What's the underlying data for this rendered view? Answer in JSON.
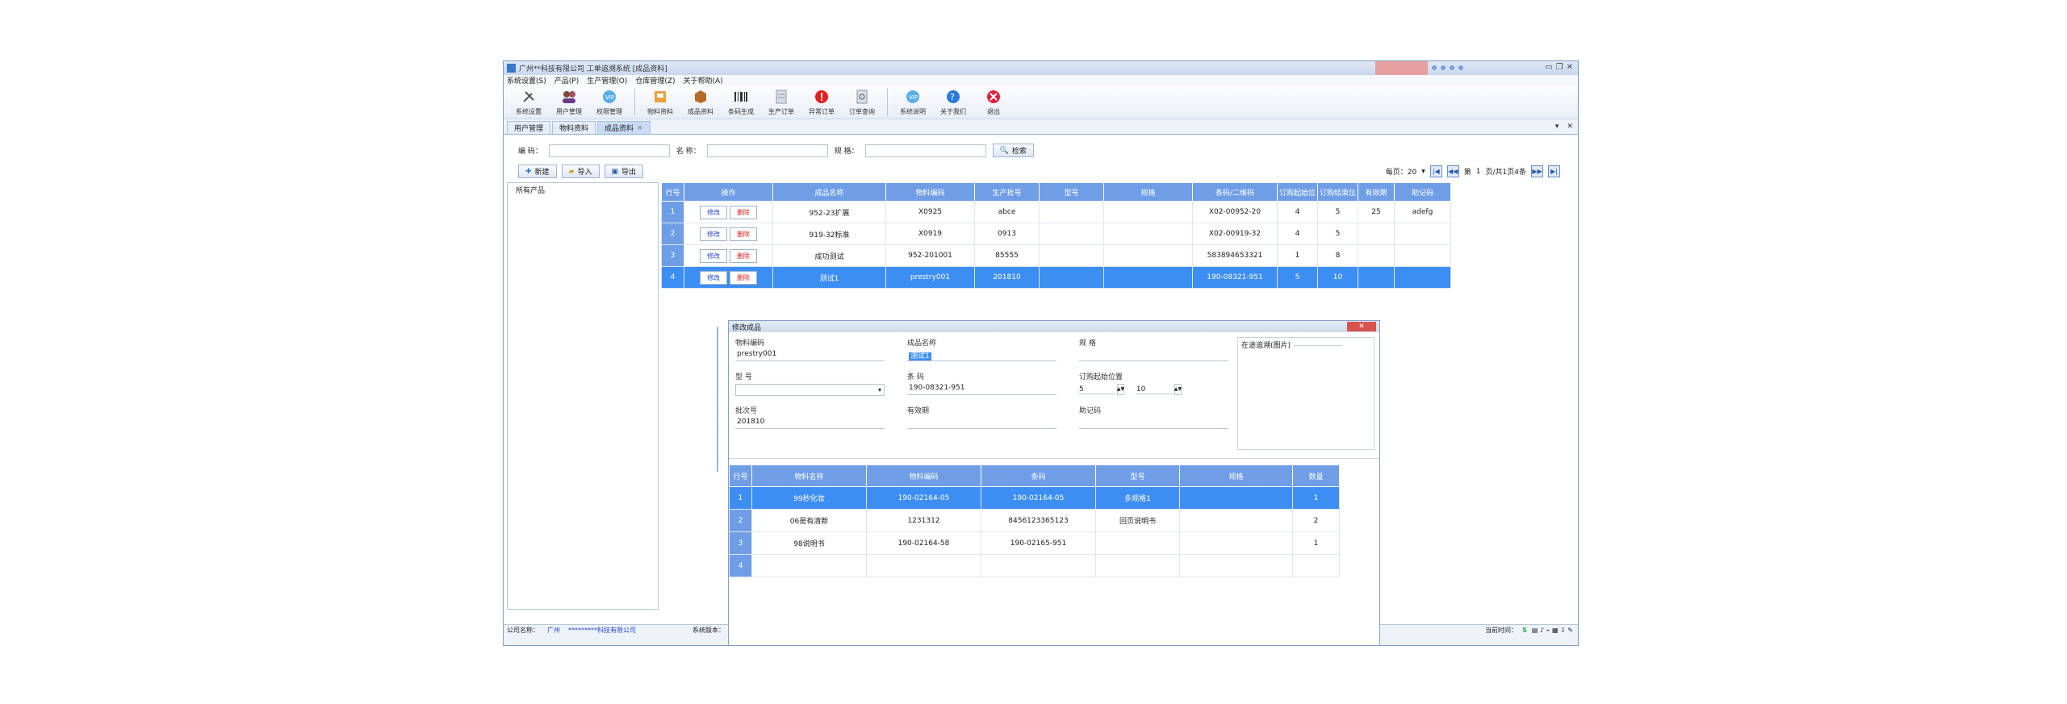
{
  "window": {
    "title": "广州**科技有限公司 工单追溯系统 [成品资料]"
  },
  "menubar": [
    "系统设置(S)",
    "产品(P)",
    "生产管理(O)",
    "仓库管理(Z)",
    "关于帮助(A)"
  ],
  "toolbar": {
    "items": [
      {
        "label": "系统设置",
        "icon": "tools-icon"
      },
      {
        "label": "用户管理",
        "icon": "users-icon"
      },
      {
        "label": "权限管理",
        "icon": "vip-icon"
      },
      {
        "label": "物料资料",
        "icon": "material-icon"
      },
      {
        "label": "成品资料",
        "icon": "box-icon"
      },
      {
        "label": "条码生成",
        "icon": "barcode-icon"
      },
      {
        "label": "生产订单",
        "icon": "order-icon"
      },
      {
        "label": "异常订单",
        "icon": "alert-icon"
      },
      {
        "label": "订单查询",
        "icon": "query-icon"
      },
      {
        "label": "系统说明",
        "icon": "info-icon"
      },
      {
        "label": "关于我们",
        "icon": "help-icon"
      },
      {
        "label": "退出",
        "icon": "exit-icon"
      }
    ]
  },
  "tabs": [
    {
      "label": "用户管理"
    },
    {
      "label": "物料资料"
    },
    {
      "label": "成品资料",
      "active": true
    }
  ],
  "search": {
    "code_label": "编    码：",
    "name_label": "名    称：",
    "spec_label": "规    格：",
    "search_button": "检索"
  },
  "actions": {
    "new": "新建",
    "import": "导入",
    "export": "导出"
  },
  "pager": {
    "per_page": "每页：20",
    "page_label": "第",
    "page": "1",
    "total": "页/共1页4条"
  },
  "tree": {
    "root": "所有产品"
  },
  "grid": {
    "columns": [
      "行号",
      "操作",
      "成品名称",
      "物料编码",
      "生产批号",
      "型号",
      "规格",
      "条码/二维码",
      "订购起始位",
      "订购结束位",
      "有效期",
      "助记码"
    ],
    "edit_label": "修改",
    "delete_label": "删除",
    "rows": [
      {
        "no": "1",
        "name": "952-23扩展",
        "code": "X0925",
        "batch": "abce",
        "model": "",
        "spec": "",
        "barcode": "X02-00952-20",
        "start": "4",
        "end": "5",
        "valid": "25",
        "mnemonic": "adefg"
      },
      {
        "no": "2",
        "name": "919-32标准",
        "code": "X0919",
        "batch": "0913",
        "model": "",
        "spec": "",
        "barcode": "X02-00919-32",
        "start": "4",
        "end": "5",
        "valid": "",
        "mnemonic": ""
      },
      {
        "no": "3",
        "name": "成功测试",
        "code": "952-201001",
        "batch": "85555",
        "model": "",
        "spec": "",
        "barcode": "583894653321",
        "start": "1",
        "end": "8",
        "valid": "",
        "mnemonic": ""
      },
      {
        "no": "4",
        "name": "测试1",
        "code": "prestry001",
        "batch": "201810",
        "model": "",
        "spec": "",
        "barcode": "190-08321-951",
        "start": "5",
        "end": "10",
        "valid": "",
        "mnemonic": "",
        "selected": true
      }
    ]
  },
  "statusbar": {
    "company_label": "公司名称：",
    "city": "广州",
    "company": "*********科技有限公司",
    "version": "系统版本：",
    "right_text": "当前时间："
  },
  "dialog": {
    "title": "修改成品",
    "close": "✕",
    "fields": {
      "material_code_label": "物料编码",
      "material_code": "prestry001",
      "product_name_label": "成品名称",
      "product_name": "测试1",
      "spec_label": "规    格",
      "spec": "",
      "model_label": "型    号",
      "model": "",
      "barcode_label": "条    码",
      "barcode": "190-08321-951",
      "order_range_label": "订购起始位置",
      "order_start": "5",
      "order_end": "10",
      "batch_label": "批次号",
      "batch": "201810",
      "valid_label": "有效期",
      "valid": "",
      "mnemonic_label": "助记码",
      "mnemonic": ""
    },
    "picture_label": "在途追溯(图片)",
    "sub_grid": {
      "columns": [
        "行号",
        "物料名称",
        "物料编码",
        "条码",
        "型号",
        "规格",
        "数量"
      ],
      "rows": [
        {
          "no": "1",
          "name": "99秒化妆",
          "code": "190-02164-05",
          "barcode": "190-02164-05",
          "model": "多规格1",
          "spec": "",
          "qty": "1",
          "selected": true
        },
        {
          "no": "2",
          "name": "06是有清新",
          "code": "1231312",
          "barcode": "8456123365123",
          "model": "回页说明书",
          "spec": "",
          "qty": "2"
        },
        {
          "no": "3",
          "name": "98说明书",
          "code": "190-02164-58",
          "barcode": "190-02165-951",
          "model": "",
          "spec": "",
          "qty": "1"
        },
        {
          "no": "4",
          "name": "",
          "code": "",
          "barcode": "",
          "model": "",
          "spec": "",
          "qty": ""
        }
      ]
    }
  },
  "colors": {
    "header_blue": "#6f9ee6",
    "select_blue": "#3d8ef3",
    "delete_red": "#dd2222",
    "link_blue": "#2244cc"
  }
}
